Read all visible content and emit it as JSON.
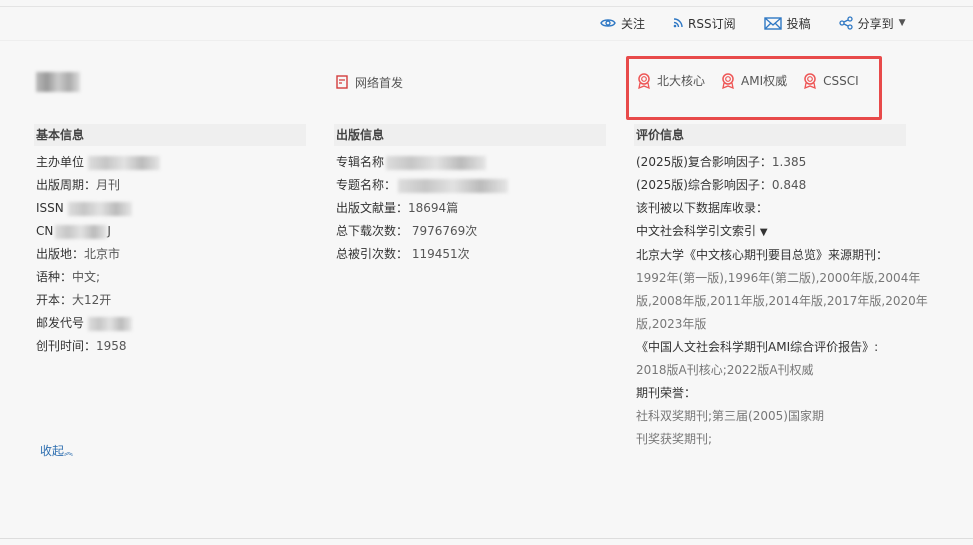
{
  "toolbar": {
    "follow": "关注",
    "rss": "RSS订阅",
    "submit": "投稿",
    "share": "分享到"
  },
  "header": {
    "network_first": "网络首发"
  },
  "badges": [
    "北大核心",
    "AMI权威",
    "CSSCI"
  ],
  "basic": {
    "title": "基本信息",
    "sponsor": "主办单位",
    "period": "出版周期：",
    "period_v": "月刊",
    "issn": "ISSN",
    "cn": "CN",
    "cn_suffix": "J",
    "place": "出版地：",
    "place_v": "北京市",
    "lang": "语种：",
    "lang_v": "中文;",
    "format": "开本：",
    "format_v": "大12开",
    "postal": "邮发代号",
    "founded": "创刊时间：",
    "founded_v": "1958"
  },
  "publish": {
    "title": "出版信息",
    "album": "专辑名称",
    "topic": "专题名称：",
    "count": "出版文献量：",
    "count_v": "18694篇",
    "downloads": "总下载次数：",
    "downloads_v": "7976769次",
    "cites": "总被引次数：",
    "cites_v": "119451次"
  },
  "eval": {
    "title": "评价信息",
    "if1": "(2025版)复合影响因子：",
    "if1_v": "1.385",
    "if2": "(2025版)综合影响因子：",
    "if2_v": "0.848",
    "db": "该刊被以下数据库收录：",
    "db_sel": "中文社会科学引文索引",
    "pku": "北京大学《中文核心期刊要目总览》来源期刊：",
    "pku_1": "1992年(第一版),1996年(第二版),2000年版,2004年",
    "pku_2": "版,2008年版,2011年版,2014年版,2017年版,2020年",
    "pku_3": "版,2023年版",
    "ami": "《中国人文社会科学期刊AMI综合评价报告》:",
    "ami_v": "2018版A刊核心;2022版A刊权威",
    "honor": "期刊荣誉：",
    "honor_1": "社科双奖期刊;第三届(2005)国家期",
    "honor_2": "刊奖获奖期刊;"
  },
  "collapse": "收起"
}
